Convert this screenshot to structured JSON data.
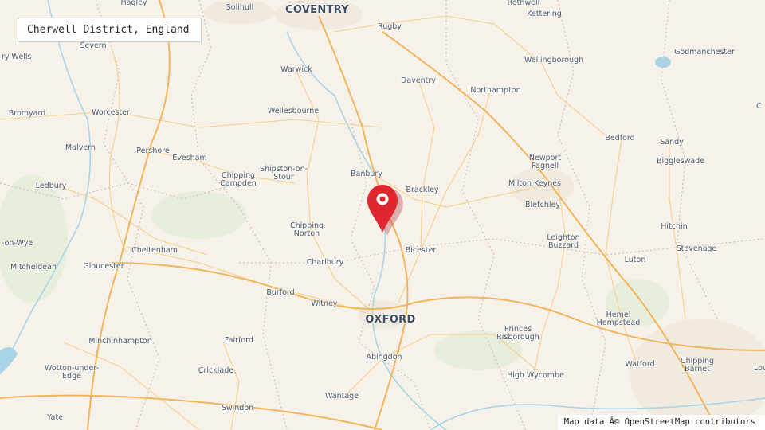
{
  "map": {
    "title": "Cherwell District, England",
    "attribution": "Map data Â© OpenStreetMap contributors",
    "marker_icon": "map-pin-icon",
    "colors": {
      "background": "#f6f2ea",
      "motorway": "#f2b55c",
      "road": "#f7cf8a",
      "water": "#a8d4e6",
      "boundary": "#cdb0c6",
      "marker": "#e0262e"
    },
    "places": [
      {
        "name": "Hagley",
        "cls": "town"
      },
      {
        "name": "Solihull",
        "cls": "town"
      },
      {
        "name": "COVENTRY",
        "cls": "city"
      },
      {
        "name": "Rothwell",
        "cls": "town"
      },
      {
        "name": "Kettering",
        "cls": "town"
      },
      {
        "name": "Rugby",
        "cls": "town"
      },
      {
        "name": "Severn",
        "cls": "town"
      },
      {
        "name": "ry Wells",
        "cls": "town"
      },
      {
        "name": "Godmanchester",
        "cls": "town"
      },
      {
        "name": "Wellingborough",
        "cls": "town"
      },
      {
        "name": "Warwick",
        "cls": "town"
      },
      {
        "name": "Daventry",
        "cls": "town"
      },
      {
        "name": "Northampton",
        "cls": "town"
      },
      {
        "name": "C",
        "cls": "town"
      },
      {
        "name": "Bromyard",
        "cls": "town"
      },
      {
        "name": "Worcester",
        "cls": "town"
      },
      {
        "name": "Wellesbourne",
        "cls": "town"
      },
      {
        "name": "Bedford",
        "cls": "town"
      },
      {
        "name": "Sandy",
        "cls": "town"
      },
      {
        "name": "Malvern",
        "cls": "town"
      },
      {
        "name": "Pershore",
        "cls": "town"
      },
      {
        "name": "Evesham",
        "cls": "town"
      },
      {
        "name": "Newport\nPagnell",
        "cls": "town"
      },
      {
        "name": "Biggleswade",
        "cls": "town"
      },
      {
        "name": "Banbury",
        "cls": "town"
      },
      {
        "name": "Shipston-on-\nStour",
        "cls": "town"
      },
      {
        "name": "Chipping\nCampden",
        "cls": "town"
      },
      {
        "name": "Brackley",
        "cls": "town"
      },
      {
        "name": "Milton Keynes",
        "cls": "town"
      },
      {
        "name": "Ledbury",
        "cls": "town"
      },
      {
        "name": "Bletchley",
        "cls": "town"
      },
      {
        "name": "Chipping\nNorton",
        "cls": "town"
      },
      {
        "name": "Hitchin",
        "cls": "town"
      },
      {
        "name": "-on-Wye",
        "cls": "town"
      },
      {
        "name": "Leighton\nBuzzard",
        "cls": "town"
      },
      {
        "name": "Bicester",
        "cls": "town"
      },
      {
        "name": "Stevenage",
        "cls": "town"
      },
      {
        "name": "Cheltenham",
        "cls": "town"
      },
      {
        "name": "Luton",
        "cls": "town"
      },
      {
        "name": "Mitcheldean",
        "cls": "town"
      },
      {
        "name": "Gloucester",
        "cls": "town"
      },
      {
        "name": "Charlbury",
        "cls": "town"
      },
      {
        "name": "Burford",
        "cls": "town"
      },
      {
        "name": "Witney",
        "cls": "town"
      },
      {
        "name": "OXFORD",
        "cls": "city"
      },
      {
        "name": "Hemel\nHempstead",
        "cls": "town"
      },
      {
        "name": "Princes\nRisborough",
        "cls": "town"
      },
      {
        "name": "Minchinhampton",
        "cls": "town"
      },
      {
        "name": "Fairford",
        "cls": "town"
      },
      {
        "name": "Abingdon",
        "cls": "town"
      },
      {
        "name": "Watford",
        "cls": "town"
      },
      {
        "name": "Chipping\nBarnet",
        "cls": "town"
      },
      {
        "name": "Lou",
        "cls": "town"
      },
      {
        "name": "Wotton-under-\nEdge",
        "cls": "town"
      },
      {
        "name": "Cricklade",
        "cls": "town"
      },
      {
        "name": "High Wycombe",
        "cls": "town"
      },
      {
        "name": "Wantage",
        "cls": "town"
      },
      {
        "name": "Swindon",
        "cls": "town"
      },
      {
        "name": "Yate",
        "cls": "town"
      }
    ]
  }
}
